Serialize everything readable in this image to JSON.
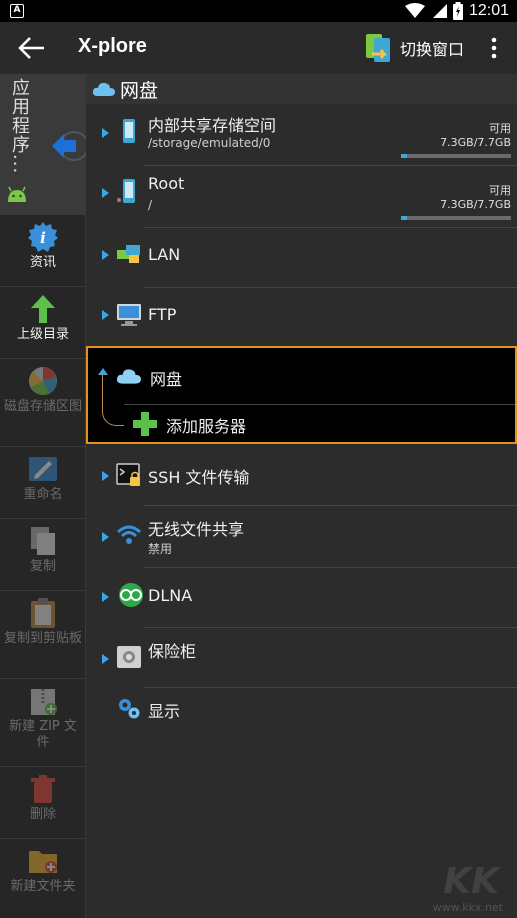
{
  "status_bar": {
    "time": "12:01",
    "left_icon_letter": "A"
  },
  "app_bar": {
    "title": "X-plore",
    "switch_window_label": "切换窗口"
  },
  "left_panel": {
    "tab_label": "应用程序..."
  },
  "toolbar": {
    "items": [
      {
        "label": "资讯",
        "icon": "info-icon",
        "enabled": true
      },
      {
        "label": "上级目录",
        "icon": "arrow-up-icon",
        "enabled": true
      },
      {
        "label": "磁盘存储区图",
        "icon": "disk-map-icon",
        "enabled": false
      },
      {
        "label": "重命名",
        "icon": "rename-icon",
        "enabled": false
      },
      {
        "label": "复制",
        "icon": "copy-icon",
        "enabled": false
      },
      {
        "label": "复制到剪贴板",
        "icon": "clipboard-icon",
        "enabled": false
      },
      {
        "label": "新建 ZIP 文件",
        "icon": "zip-icon",
        "enabled": false
      },
      {
        "label": "删除",
        "icon": "trash-icon",
        "enabled": false
      },
      {
        "label": "新建文件夹",
        "icon": "new-folder-icon",
        "enabled": false
      }
    ]
  },
  "main": {
    "header": "网盘",
    "internal_storage": {
      "title": "内部共享存储空间",
      "path": "/storage/emulated/0",
      "available_label": "可用",
      "size": "7.3GB/7.7GB",
      "used_fraction": 0.05
    },
    "root": {
      "title": "Root",
      "path": "/",
      "available_label": "可用",
      "size": "7.3GB/7.7GB",
      "used_fraction": 0.05
    },
    "lan": {
      "title": "LAN"
    },
    "ftp": {
      "title": "FTP"
    },
    "cloud": {
      "title": "网盘",
      "add_server": "添加服务器"
    },
    "ssh": {
      "title": "SSH 文件传输"
    },
    "wifi": {
      "title": "无线文件共享",
      "status": "禁用"
    },
    "dlna": {
      "title": "DLNA"
    },
    "vault": {
      "title": "保险柜"
    },
    "display": {
      "title": "显示"
    }
  },
  "colors": {
    "accent": "#3aa5e8",
    "highlight_border": "#e8901c",
    "usage_fill": "#3fa7d4"
  },
  "watermark": {
    "text": "www.kkx.net",
    "logo": "KK下载"
  }
}
